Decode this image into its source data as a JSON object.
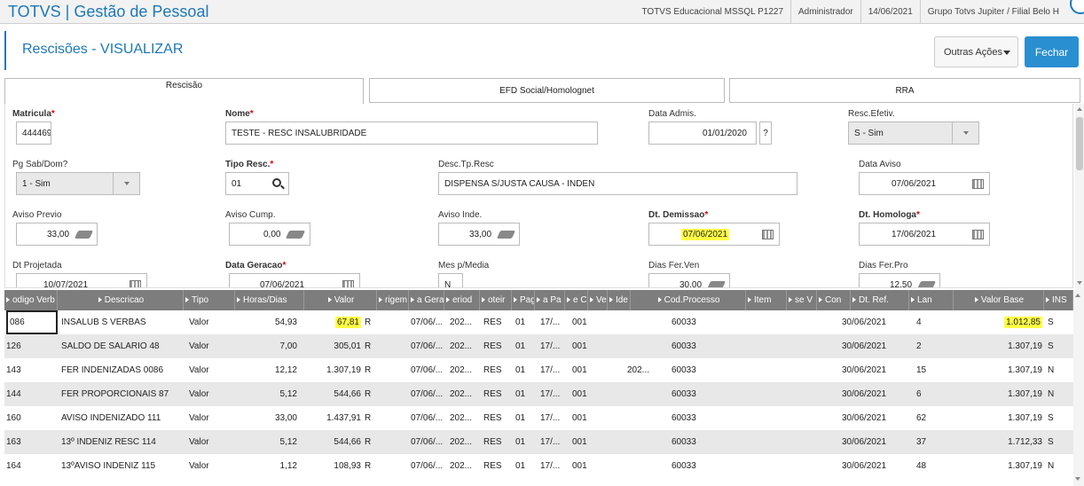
{
  "app_title": "TOTVS | Gestão de Pessoal",
  "topinfo": {
    "system": "TOTVS Educacional MSSQL P1227",
    "user": "Administrador",
    "date": "14/06/2021",
    "company": "Grupo Totvs Jupiter / Filial Belo H"
  },
  "page_title": "Rescisões - VISUALIZAR",
  "buttons": {
    "outras": "Outras Ações",
    "fechar": "Fechar"
  },
  "tabs": [
    "Rescisão",
    "EFD Social/Homolognet",
    "RRA"
  ],
  "form": {
    "matricula": {
      "label": "Matricula",
      "value": "444469"
    },
    "nome": {
      "label": "Nome",
      "value": "TESTE - RESC INSALUBRIDADE"
    },
    "data_admis": {
      "label": "Data Admis.",
      "value": "01/01/2020"
    },
    "resc_efetiv": {
      "label": "Resc.Efetiv.",
      "value": "S - Sim"
    },
    "pg_sab": {
      "label": "Pg Sab/Dom?",
      "value": "1 - Sim"
    },
    "tipo_resc": {
      "label": "Tipo Resc.",
      "value": "01"
    },
    "desc_tp": {
      "label": "Desc.Tp.Resc",
      "value": "DISPENSA S/JUSTA CAUSA - INDEN"
    },
    "data_aviso": {
      "label": "Data Aviso",
      "value": "07/06/2021"
    },
    "aviso_previo": {
      "label": "Aviso Previo",
      "value": "33,00"
    },
    "aviso_cump": {
      "label": "Aviso Cump.",
      "value": "0,00"
    },
    "aviso_inde": {
      "label": "Aviso Inde.",
      "value": "33,00"
    },
    "dt_demissao": {
      "label": "Dt. Demissao",
      "value": "07/06/2021"
    },
    "dt_homologa": {
      "label": "Dt. Homologa",
      "value": "17/06/2021"
    },
    "dt_projetada": {
      "label": "Dt Projetada",
      "value": "10/07/2021"
    },
    "data_geracao": {
      "label": "Data Geracao",
      "value": "07/06/2021"
    },
    "mes_media": {
      "label": "Mes p/Media",
      "value": "N"
    },
    "dias_fer_ven": {
      "label": "Dias Fer.Ven",
      "value": "30,00"
    },
    "dias_fer_pro": {
      "label": "Dias Fer.Pro",
      "value": "12,50"
    },
    "q": "?"
  },
  "grid": {
    "headers": [
      "odigo Verb",
      "Descricao",
      "Tipo",
      "Horas/Dias",
      "Valor",
      "rigem",
      "a Gerac",
      "eriod",
      "oteir",
      "Pag",
      "a Pa",
      "e Cu",
      "Ve",
      "Ide",
      "Cod.Processo",
      "Item",
      "se V",
      "Con",
      "Dt. Ref.",
      "Lan",
      "Valor Base",
      "INS"
    ],
    "rows": [
      [
        "086",
        "INSALUB S VERBAS",
        "Valor",
        "54,93",
        "67,81",
        "R",
        "07/06/...",
        "202...",
        "RES",
        "01",
        "17/...",
        "001",
        "",
        "60033",
        "30/06/2021",
        "4",
        "1.012,85",
        "S"
      ],
      [
        "126",
        "SALDO DE SALARIO 48",
        "Valor",
        "7,00",
        "305,01",
        "R",
        "07/06/...",
        "202...",
        "RES",
        "01",
        "17/...",
        "001",
        "",
        "60033",
        "30/06/2021",
        "2",
        "1.307,19",
        "S"
      ],
      [
        "143",
        "FER INDENIZADAS 0086",
        "Valor",
        "12,12",
        "1.307,19",
        "R",
        "07/06/...",
        "202...",
        "RES",
        "01",
        "17/...",
        "001",
        "202...",
        "60033",
        "30/06/2021",
        "15",
        "1.307,19",
        "N"
      ],
      [
        "144",
        "FER PROPORCIONAIS 87",
        "Valor",
        "5,12",
        "544,66",
        "R",
        "07/06/...",
        "202...",
        "RES",
        "01",
        "17/...",
        "001",
        "",
        "60033",
        "30/06/2021",
        "6",
        "1.307,19",
        "N"
      ],
      [
        "160",
        "AVISO INDENIZADO 111",
        "Valor",
        "33,00",
        "1.437,91",
        "R",
        "07/06/...",
        "202...",
        "RES",
        "01",
        "17/...",
        "001",
        "",
        "60033",
        "30/06/2021",
        "62",
        "1.307,19",
        "S"
      ],
      [
        "163",
        "13º INDENIZ RESC 114",
        "Valor",
        "5,12",
        "544,66",
        "R",
        "07/06/...",
        "202...",
        "RES",
        "01",
        "17/...",
        "001",
        "",
        "60033",
        "30/06/2021",
        "37",
        "1.712,33",
        "S"
      ],
      [
        "164",
        "13ºAVISO INDENIZ 115",
        "Valor",
        "1,12",
        "108,93",
        "R",
        "07/06/...",
        "202...",
        "RES",
        "01",
        "17/...",
        "001",
        "",
        "60033",
        "30/06/2021",
        "48",
        "1.307,19",
        "N"
      ]
    ]
  }
}
